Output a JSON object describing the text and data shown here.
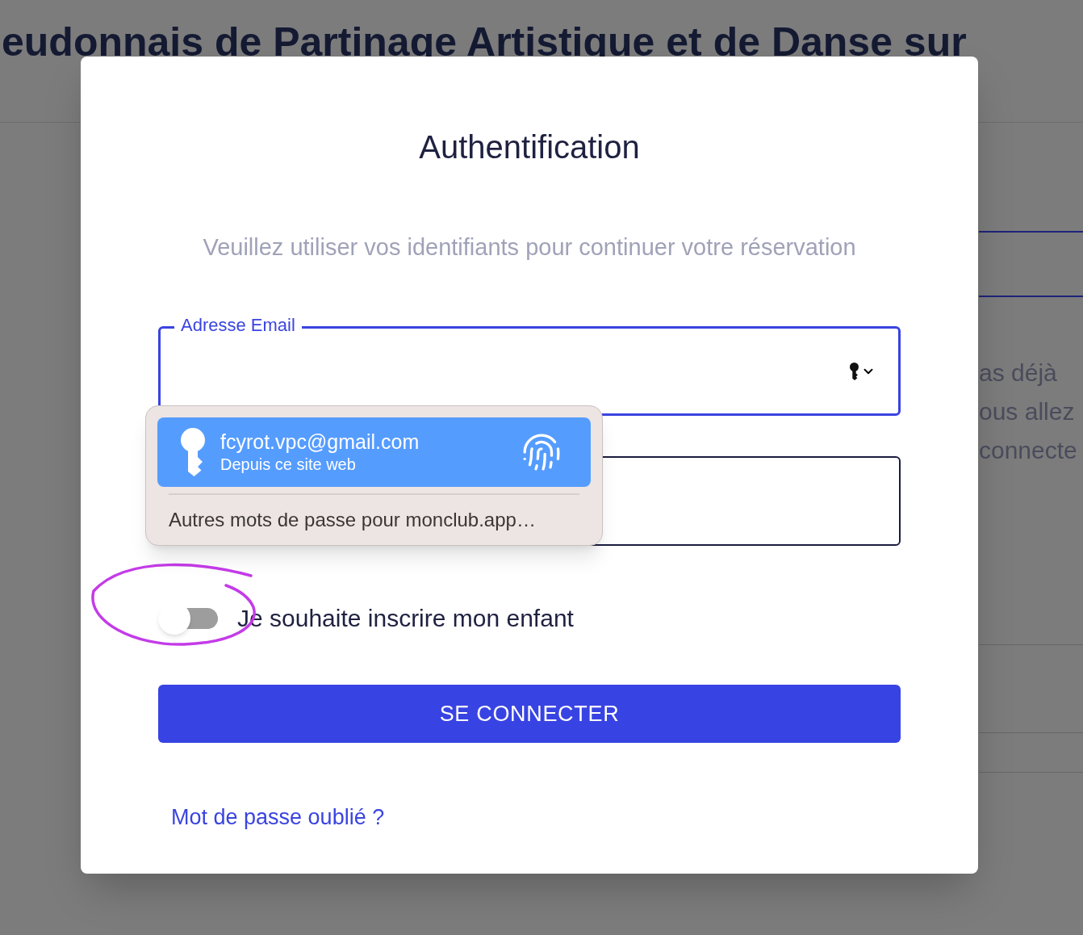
{
  "page": {
    "heading": "eudonnais de Partinage Artistique et de Danse sur",
    "side_texts": [
      "as déjà",
      "ous allez",
      "connecte"
    ]
  },
  "dialog": {
    "title": "Authentification",
    "subtitle": "Veuillez utiliser vos identifiants pour continuer votre réservation",
    "email_field": {
      "label": "Adresse Email"
    },
    "toggle": {
      "label": "Je souhaite inscrire mon enfant",
      "on": false
    },
    "button": "SE CONNECTER",
    "link": "Mot de passe oublié ?"
  },
  "autofill": {
    "suggestions": [
      {
        "title": "fcyrot.vpc@gmail.com",
        "subtitle": "Depuis ce site web",
        "selected": true
      }
    ],
    "more": "Autres mots de passe pour monclub.app…"
  }
}
